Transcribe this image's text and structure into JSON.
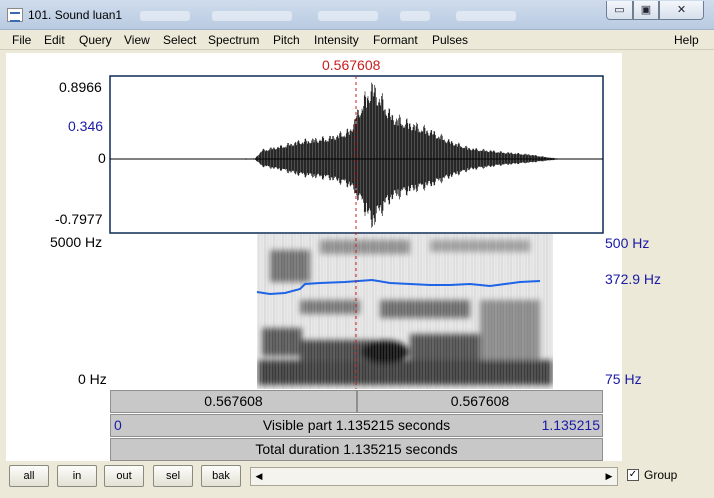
{
  "window": {
    "title": "101. Sound luan1",
    "minimize_glyph": "▭",
    "maximize_glyph": "▣",
    "close_glyph": "✕"
  },
  "menu": [
    "File",
    "Edit",
    "Query",
    "View",
    "Select",
    "Spectrum",
    "Pitch",
    "Intensity",
    "Formant",
    "Pulses",
    "Help"
  ],
  "cursor": {
    "time_label": "0.567608",
    "time_seconds": 0.567608
  },
  "waveform": {
    "max_label": "0.8966",
    "cursor_value_label": "0.346",
    "zero_label": "0",
    "min_label": "-0.7977"
  },
  "spectrogram": {
    "top_freq_label": "5000 Hz",
    "bottom_freq_label": "0 Hz",
    "pitch_top_label": "500 Hz",
    "pitch_cursor_label": "372.9 Hz",
    "pitch_bottom_label": "75 Hz"
  },
  "rulers": {
    "left_segment": "0.567608",
    "right_segment": "0.567608",
    "visible_start": "0",
    "visible_part": "Visible part 1.135215 seconds",
    "visible_end": "1.135215",
    "total_duration": "Total duration 1.135215 seconds"
  },
  "toolbar": {
    "all": "all",
    "in": "in",
    "out": "out",
    "sel": "sel",
    "bak": "bak",
    "scroll_left_glyph": "◀",
    "scroll_right_glyph": "▶",
    "group_checked_glyph": "✓",
    "group_label": "Group",
    "group_checked": true
  },
  "colors": {
    "waveform": "#000000",
    "cursor": "#c81e1e",
    "pitch_contour": "#1e64e6",
    "labels_blue": "#1a1aa6"
  }
}
